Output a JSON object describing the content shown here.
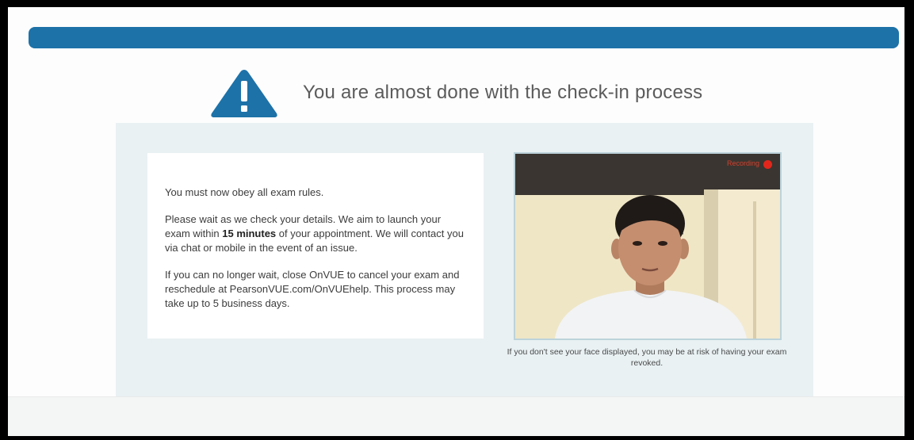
{
  "header": {
    "title": "You are almost done with the check-in process",
    "icon": "warning-triangle-icon"
  },
  "colors": {
    "accent": "#1d72a8",
    "panel": "#e9f1f3",
    "recording": "#e3261b"
  },
  "info": {
    "p1": "You must now obey all exam rules.",
    "p2_before": "Please wait as we check your details. We aim to launch your exam within ",
    "p2_bold": "15 minutes",
    "p2_after": " of your appointment. We will contact you via chat or mobile in the event of an issue.",
    "p3": "If you can no longer wait, close OnVUE to cancel your exam and reschedule at PearsonVUE.com/OnVUEhelp. This process may take up to 5 business days."
  },
  "camera": {
    "recording_label": "Recording",
    "note": "If you don't see your face displayed, you may be at risk of having your exam revoked."
  }
}
